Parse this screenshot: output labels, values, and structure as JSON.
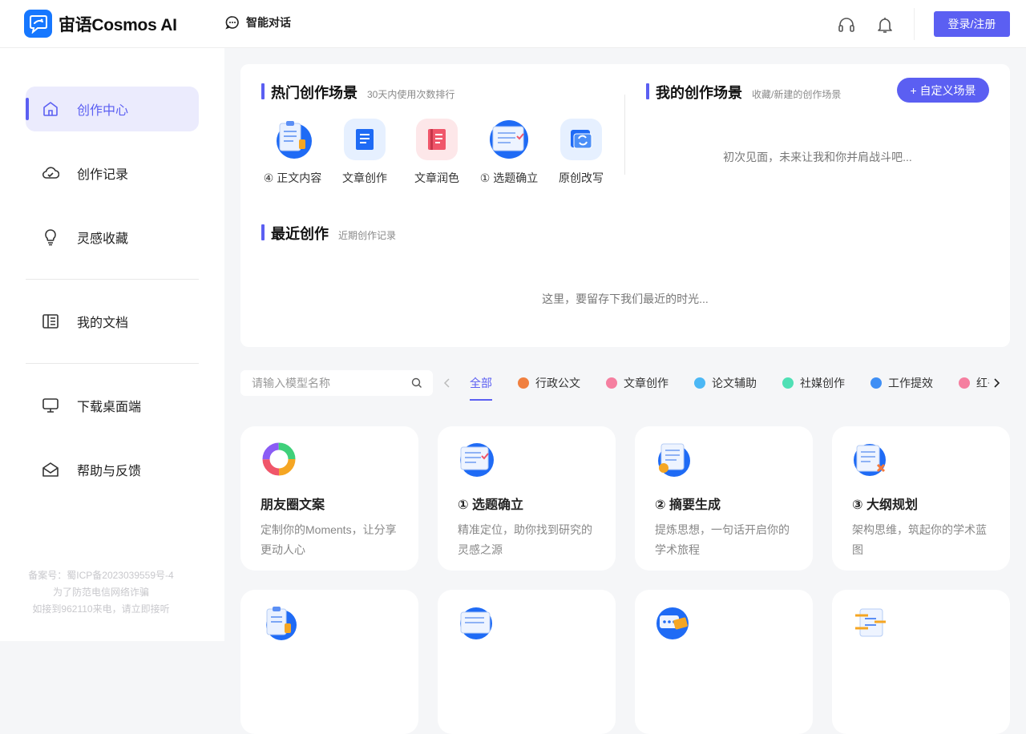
{
  "header": {
    "logo_text": "宙语Cosmos AI",
    "chat_label": "智能对话",
    "login_label": "登录/注册",
    "icons": [
      "headset-icon",
      "bell-icon"
    ]
  },
  "sidebar": {
    "items": [
      {
        "label": "创作中心",
        "icon": "home-icon",
        "active": true
      },
      {
        "label": "创作记录",
        "icon": "cloud-icon"
      },
      {
        "label": "灵感收藏",
        "icon": "lightbulb-icon"
      },
      {
        "label": "我的文档",
        "icon": "book-icon"
      },
      {
        "label": "下载桌面端",
        "icon": "monitor-icon"
      },
      {
        "label": "帮助与反馈",
        "icon": "mail-icon"
      }
    ],
    "footer": [
      "备案号：蜀ICP备2023039559号-4",
      "为了防范电信网络诈骗",
      "如接到962110来电，请立即接听"
    ]
  },
  "hot": {
    "title": "热门创作场景",
    "subtitle": "30天内使用次数排行",
    "items": [
      {
        "label": "④ 正文内容"
      },
      {
        "label": "文章创作"
      },
      {
        "label": "文章润色"
      },
      {
        "label": "① 选题确立"
      },
      {
        "label": "原创改写"
      }
    ]
  },
  "mine": {
    "title": "我的创作场景",
    "subtitle": "收藏/新建的创作场景",
    "button_label": "+ 自定义场景",
    "empty": "初次见面，未来让我和你并肩战斗吧..."
  },
  "recent": {
    "title": "最近创作",
    "subtitle": "近期创作记录",
    "empty": "这里，要留存下我们最近的时光..."
  },
  "filter": {
    "search_placeholder": "请输入模型名称",
    "tabs": [
      {
        "label": "全部",
        "active": true
      },
      {
        "label": "行政公文",
        "color": "#f08040"
      },
      {
        "label": "文章创作",
        "color": "#f57fa0"
      },
      {
        "label": "论文辅助",
        "color": "#4cb8f5"
      },
      {
        "label": "社媒创作",
        "color": "#4fe0b5"
      },
      {
        "label": "工作提效",
        "color": "#3f8ff5"
      },
      {
        "label": "红书",
        "color": "#f57fa0"
      }
    ]
  },
  "cards": [
    {
      "title": "朋友圈文案",
      "desc": "定制你的Moments，让分享更动人心"
    },
    {
      "title": "① 选题确立",
      "desc": "精准定位，助你找到研究的灵感之源"
    },
    {
      "title": "② 摘要生成",
      "desc": "提炼思想，一句话开启你的学术旅程"
    },
    {
      "title": "③ 大纲规划",
      "desc": "架构思维，筑起你的学术蓝图"
    }
  ]
}
